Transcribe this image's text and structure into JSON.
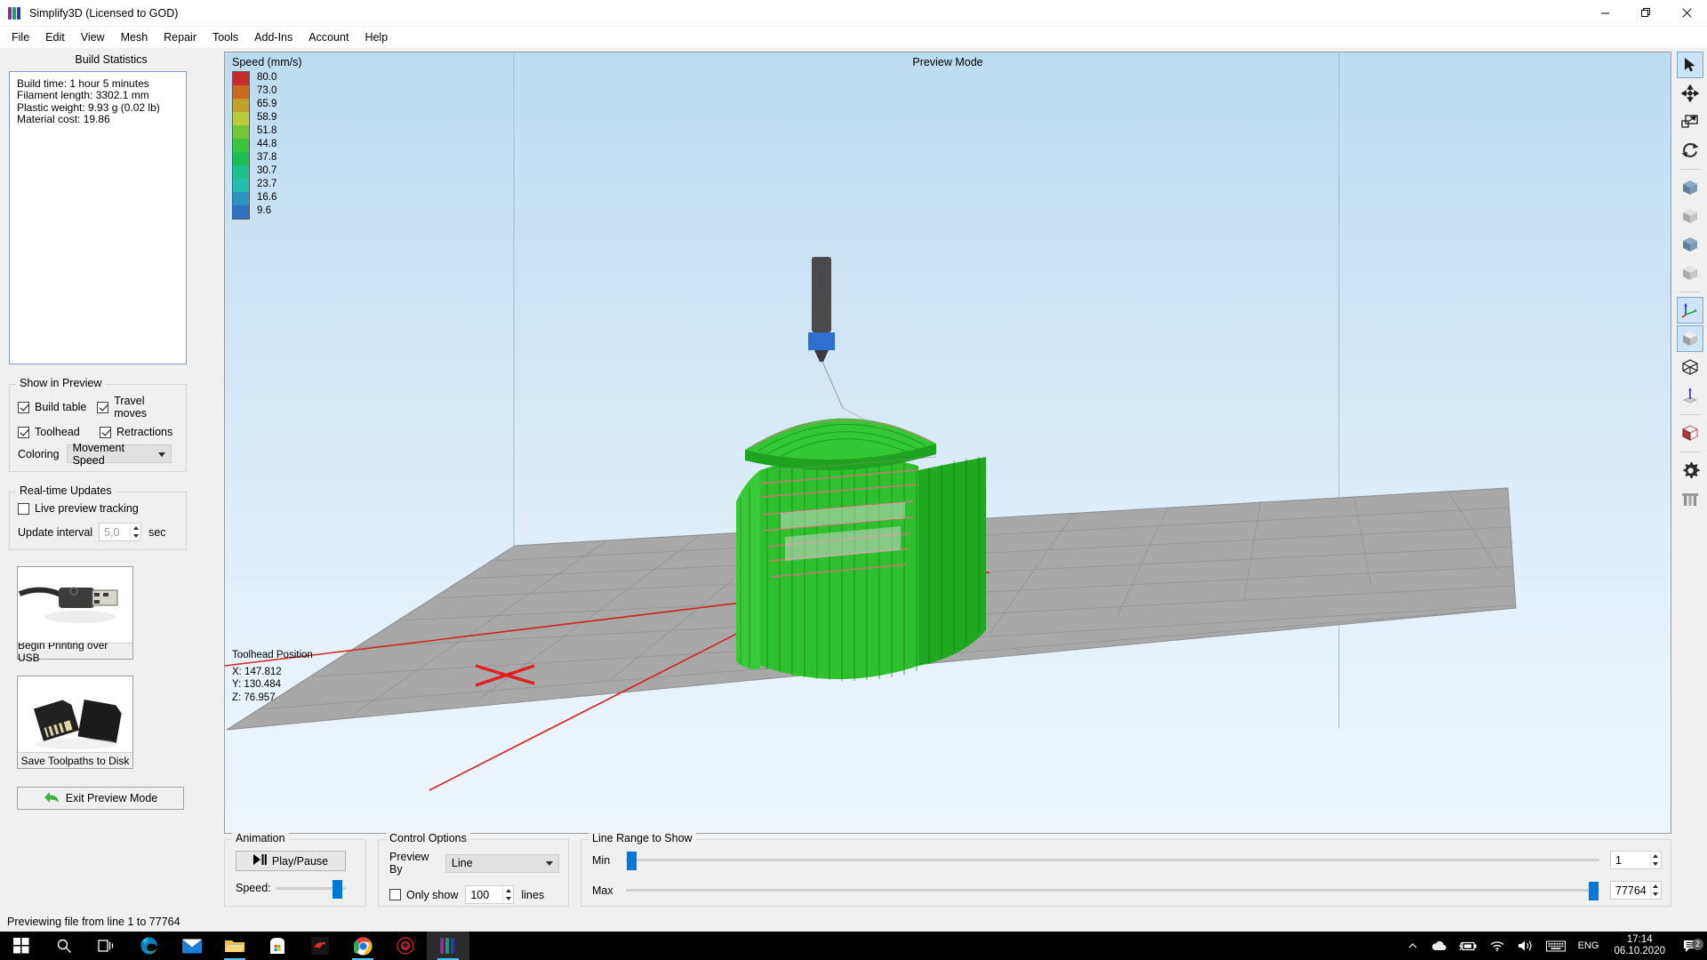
{
  "window": {
    "title": "Simplify3D (Licensed to GOD)",
    "minimize": "minimize",
    "maximize": "restore",
    "close": "close"
  },
  "menu": [
    "File",
    "Edit",
    "View",
    "Mesh",
    "Repair",
    "Tools",
    "Add-Ins",
    "Account",
    "Help"
  ],
  "sidebar": {
    "build_statistics": {
      "title": "Build Statistics",
      "lines": [
        "Build time: 1 hour 5 minutes",
        "Filament length: 3302.1 mm",
        "Plastic weight: 9.93 g (0.02 lb)",
        "Material cost: 19.86"
      ]
    },
    "show_in_preview": {
      "title": "Show in Preview",
      "checkboxes": [
        {
          "label": "Build table",
          "checked": true
        },
        {
          "label": "Travel moves",
          "checked": true
        },
        {
          "label": "Toolhead",
          "checked": true
        },
        {
          "label": "Retractions",
          "checked": true
        }
      ],
      "coloring_label": "Coloring",
      "coloring_value": "Movement Speed"
    },
    "realtime_updates": {
      "title": "Real-time Updates",
      "live_preview_label": "Live preview tracking",
      "live_preview_checked": false,
      "update_interval_label": "Update interval",
      "update_interval_value": "5,0",
      "update_interval_unit": "sec"
    },
    "usb_button": "Begin Printing over USB",
    "sd_button": "Save Toolpaths to Disk",
    "exit_button": "Exit Preview Mode"
  },
  "viewport": {
    "mode_label": "Preview Mode",
    "legend": {
      "title": "Speed (mm/s)",
      "entries": [
        {
          "value": "80.0",
          "color": "#c62b2b"
        },
        {
          "value": "73.0",
          "color": "#c96a22"
        },
        {
          "value": "65.9",
          "color": "#c2a02c"
        },
        {
          "value": "58.9",
          "color": "#b8cc3c"
        },
        {
          "value": "51.8",
          "color": "#72c736"
        },
        {
          "value": "44.8",
          "color": "#39c43a"
        },
        {
          "value": "37.8",
          "color": "#1cbd52"
        },
        {
          "value": "30.7",
          "color": "#1cc08a"
        },
        {
          "value": "23.7",
          "color": "#25bdb0"
        },
        {
          "value": "16.6",
          "color": "#2a93c4"
        },
        {
          "value": "9.6",
          "color": "#2e6fc0"
        }
      ]
    },
    "toolhead_position": {
      "title": "Toolhead Position",
      "x": "X: 147.812",
      "y": "Y: 130.484",
      "z": "Z: 76.957"
    }
  },
  "bottom": {
    "animation": {
      "title": "Animation",
      "play_pause": "Play/Pause",
      "speed_label": "Speed:",
      "speed_percent": 96
    },
    "control_options": {
      "title": "Control Options",
      "preview_by_label": "Preview By",
      "preview_by_value": "Line",
      "only_show_label": "Only show",
      "only_show_checked": false,
      "lines_value": "100",
      "lines_unit": "lines"
    },
    "line_range": {
      "title": "Line Range to Show",
      "min_label": "Min",
      "max_label": "Max",
      "min_value": "1",
      "max_value": "77764",
      "min_percent": 0,
      "max_percent": 100
    }
  },
  "right_toolbar": [
    {
      "name": "select-arrow-tool",
      "active": true
    },
    {
      "name": "move-tool",
      "active": false
    },
    {
      "name": "scale-tool",
      "active": false
    },
    {
      "name": "rotate-tool",
      "active": false
    },
    {
      "name": "view-front-tool",
      "active": false
    },
    {
      "name": "view-back-tool",
      "active": false
    },
    {
      "name": "view-left-tool",
      "active": false
    },
    {
      "name": "view-right-tool",
      "active": false
    },
    {
      "name": "axes-tool",
      "active": true
    },
    {
      "name": "solid-view-tool",
      "active": true
    },
    {
      "name": "wireframe-view-tool",
      "active": false
    },
    {
      "name": "normals-tool",
      "active": false
    },
    {
      "name": "cross-section-tool",
      "active": false
    },
    {
      "name": "settings-gear-tool",
      "active": false
    },
    {
      "name": "supports-tool",
      "active": false
    }
  ],
  "statusbar": {
    "text": "Previewing file from line 1 to 77764"
  },
  "taskbar": {
    "icons": [
      {
        "name": "start-button"
      },
      {
        "name": "search-icon"
      },
      {
        "name": "task-view-icon"
      },
      {
        "name": "edge-icon"
      },
      {
        "name": "mail-icon"
      },
      {
        "name": "file-explorer-icon"
      },
      {
        "name": "microsoft-store-icon"
      },
      {
        "name": "app-red-icon"
      },
      {
        "name": "chrome-icon"
      },
      {
        "name": "amd-radeon-icon"
      },
      {
        "name": "simplify3d-icon"
      }
    ],
    "tray": {
      "language": "ENG",
      "time": "17:14",
      "date": "06.10.2020",
      "notification_count": "2"
    }
  }
}
